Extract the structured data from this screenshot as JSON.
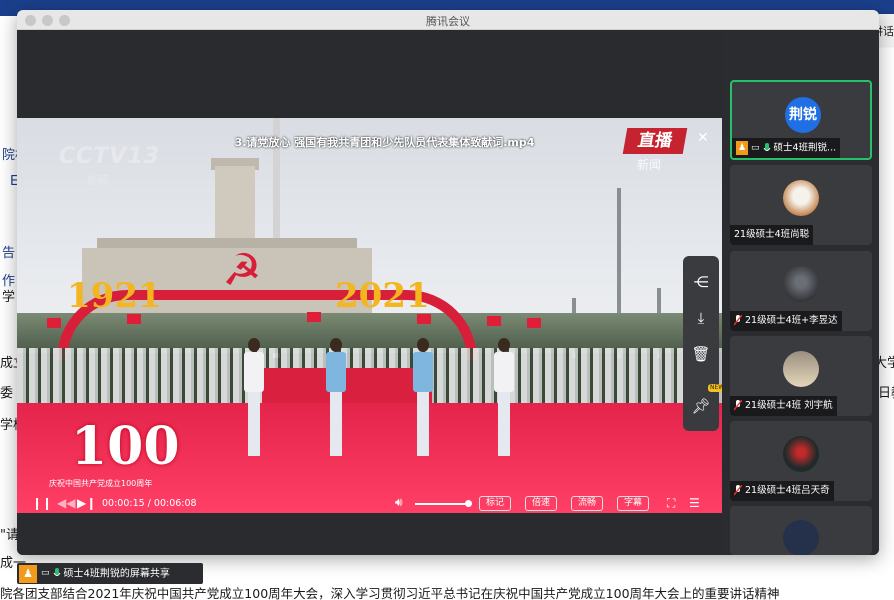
{
  "window": {
    "title": "腾讯会议"
  },
  "speaking": {
    "label": "正在讲话"
  },
  "background": {
    "left_fragments": [
      "院机",
      "El",
      "告",
      "作",
      "学",
      "成立",
      "委",
      "学校",
      "\"请",
      "成一"
    ],
    "right_fragments": [
      "大学",
      "日教"
    ],
    "bottom_line": "院各团支部结合2021年庆祝中国共产党成立100周年大会，深入学习贯彻习近平总书记在庆祝中国共产党成立100周年大会上的重要讲话精神"
  },
  "video": {
    "file_title": "3.请党放心 强国有我共青团和少先队员代表集体致献词.mp4",
    "channel_logo": "CCTV13",
    "channel_sub": "新闻",
    "live_label": "直播",
    "live_sub": "新闻",
    "year_left": "1921",
    "year_right": "2021",
    "anniversary": "100",
    "anniversary_sub": "庆祝中国共产党成立100周年",
    "current_time": "00:00:15",
    "total_time": "00:06:08",
    "time_display": "00:00:15 / 00:06:08",
    "volume": 0.85,
    "buttons": [
      "标记",
      "倍速",
      "流畅",
      "字幕"
    ]
  },
  "icons": {
    "close": "close-icon",
    "play_pause": "pause-icon",
    "rewind": "skip-back-icon",
    "forward": "skip-forward-icon",
    "volume": "volume-icon",
    "fullscreen": "fullscreen-icon",
    "playlist": "playlist-icon",
    "share": "share-icon",
    "download": "download-icon",
    "delete": "trash-icon",
    "pin": "pin-icon"
  },
  "float_tag": "NEW",
  "participants": [
    {
      "name": "硕士4班荆锐...",
      "avatar_text": "荆锐",
      "avatar_type": "initials",
      "is_host": true,
      "is_sharing": true,
      "active": true
    },
    {
      "name": "21级硕士4班尚聪",
      "avatar_type": "photo",
      "is_host": false,
      "is_sharing": false,
      "active": false
    },
    {
      "name": "21级硕士4班+李昱达",
      "avatar_type": "photo",
      "is_host": false,
      "is_sharing": false,
      "active": false
    },
    {
      "name": "21级硕士4班 刘宇航",
      "avatar_type": "photo",
      "is_host": false,
      "is_sharing": false,
      "active": false
    },
    {
      "name": "21级硕士4班吕天奇",
      "avatar_type": "photo",
      "is_host": false,
      "is_sharing": false,
      "active": false
    }
  ],
  "screen_share": {
    "label": "硕士4班荆锐的屏幕共享"
  },
  "colors": {
    "host_badge": "#f29a1a",
    "active_border": "#25c26b",
    "avatar_blue": "#1f6fe5",
    "live_red": "#c52330",
    "stage_red": "#ff3f66"
  }
}
